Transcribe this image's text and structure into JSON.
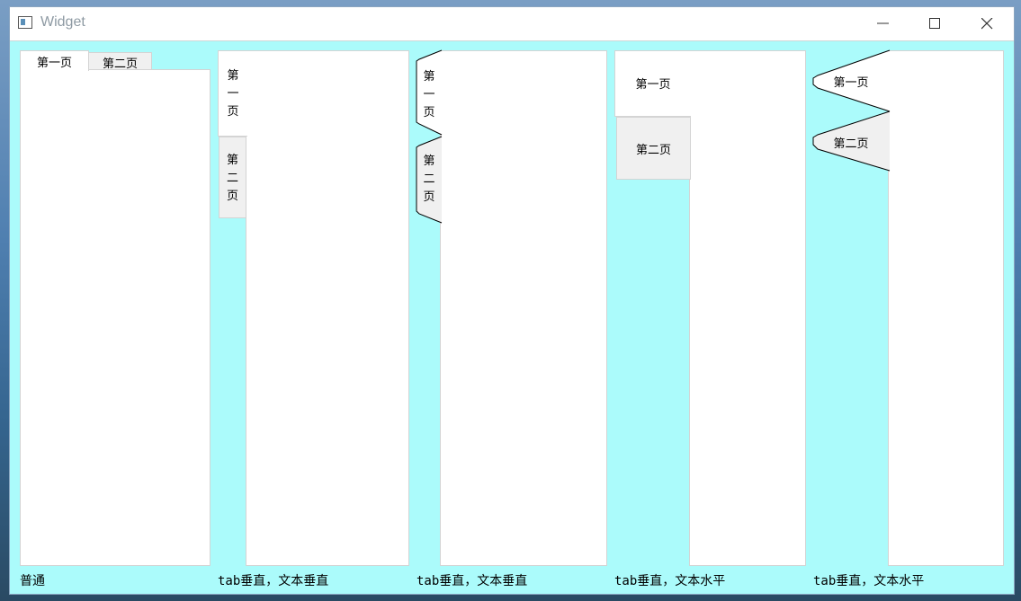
{
  "window": {
    "title": "Widget"
  },
  "titlebar_buttons": {
    "minimize": "minimize-icon",
    "maximize": "maximize-icon",
    "close": "close-icon"
  },
  "widget1": {
    "tabs": [
      "第一页",
      "第二页"
    ],
    "caption": "普通"
  },
  "widget2": {
    "tabs": [
      [
        "第",
        "一",
        "页"
      ],
      [
        "第",
        "二",
        "页"
      ]
    ],
    "caption": "tab垂直，文本垂直"
  },
  "widget3": {
    "tabs": [
      [
        "第",
        "一",
        "页"
      ],
      [
        "第",
        "二",
        "页"
      ]
    ],
    "caption": "tab垂直，文本垂直"
  },
  "widget4": {
    "tabs": [
      "第一页",
      "第二页"
    ],
    "caption": "tab垂直，文本水平"
  },
  "widget5": {
    "tabs": [
      "第一页",
      "第二页"
    ],
    "caption": "tab垂直，文本水平"
  },
  "colors": {
    "window_background": "#abfbfb",
    "tab_selected": "#ffffff",
    "tab_unselected": "#f0f0f0"
  }
}
